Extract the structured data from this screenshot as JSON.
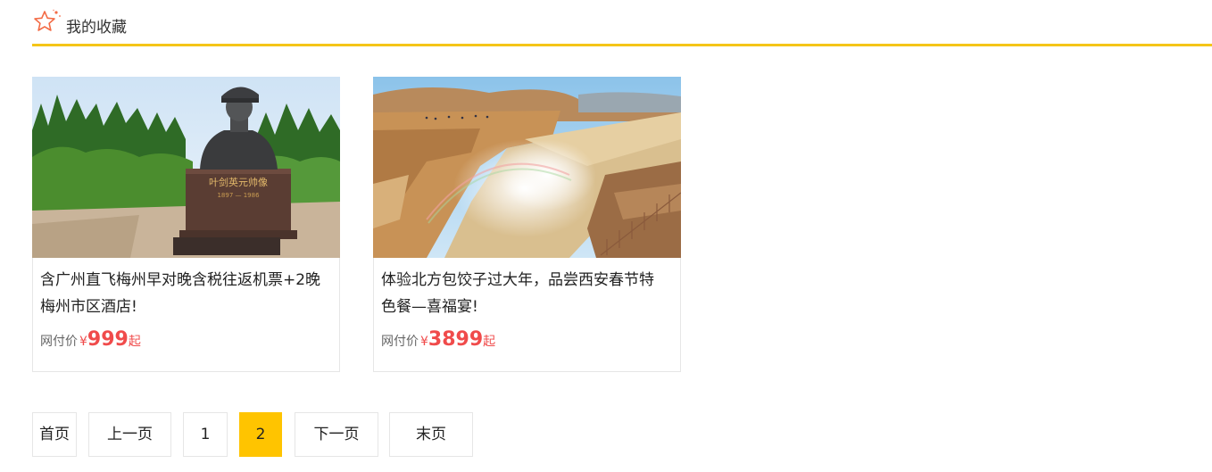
{
  "header": {
    "title": "我的收藏",
    "icon": "star-icon",
    "accent_color": "#f5c518"
  },
  "cards": [
    {
      "title": "含广州直飞梅州早对晚含税往返机票+2晚梅州市区酒店!",
      "price_label": "网付价",
      "currency": "¥",
      "price": "999",
      "price_suffix": "起",
      "statue_plaque": "叶剑英元帅像",
      "statue_years": "1897 — 1986"
    },
    {
      "title": "体验北方包饺子过大年，品尝西安春节特色餐—喜福宴!",
      "price_label": "网付价",
      "currency": "¥",
      "price": "3899",
      "price_suffix": "起"
    }
  ],
  "pagination": {
    "first": "首页",
    "prev": "上一页",
    "pages": [
      "1",
      "2"
    ],
    "current": "2",
    "next": "下一页",
    "last": "末页",
    "active_color": "#ffc400"
  },
  "price_color": "#f04b4b"
}
